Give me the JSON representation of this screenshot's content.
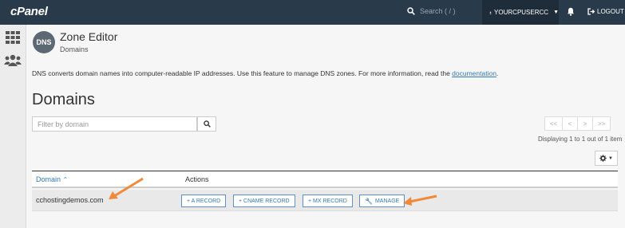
{
  "topbar": {
    "logo": "cPanel",
    "search_placeholder": "Search ( / )",
    "user": "YOURCPUSERCC",
    "logout": "LOGOUT"
  },
  "page": {
    "title": "Zone Editor",
    "subtitle": "Domains",
    "app_icon_text": "DNS",
    "description": "DNS converts domain names into computer-readable IP addresses. Use this feature to manage DNS zones. For more information, read the ",
    "description_link": "documentation",
    "description_end": ".",
    "section_title": "Domains"
  },
  "filter": {
    "placeholder": "Filter by domain"
  },
  "pagination": {
    "buttons": [
      "<<",
      "<",
      ">",
      ">>"
    ],
    "info": "Displaying 1 to 1 out of 1 item"
  },
  "table": {
    "headers": {
      "domain": "Domain",
      "actions": "Actions"
    },
    "rows": [
      {
        "domain": "cchostingdemos.com",
        "actions": [
          "+ A RECORD",
          "+ CNAME RECORD",
          "+ MX RECORD",
          "MANAGE"
        ]
      }
    ]
  },
  "colors": {
    "topbar": "#293a4a",
    "link": "#337ab7",
    "annotation_arrow": "#f08a3a"
  }
}
